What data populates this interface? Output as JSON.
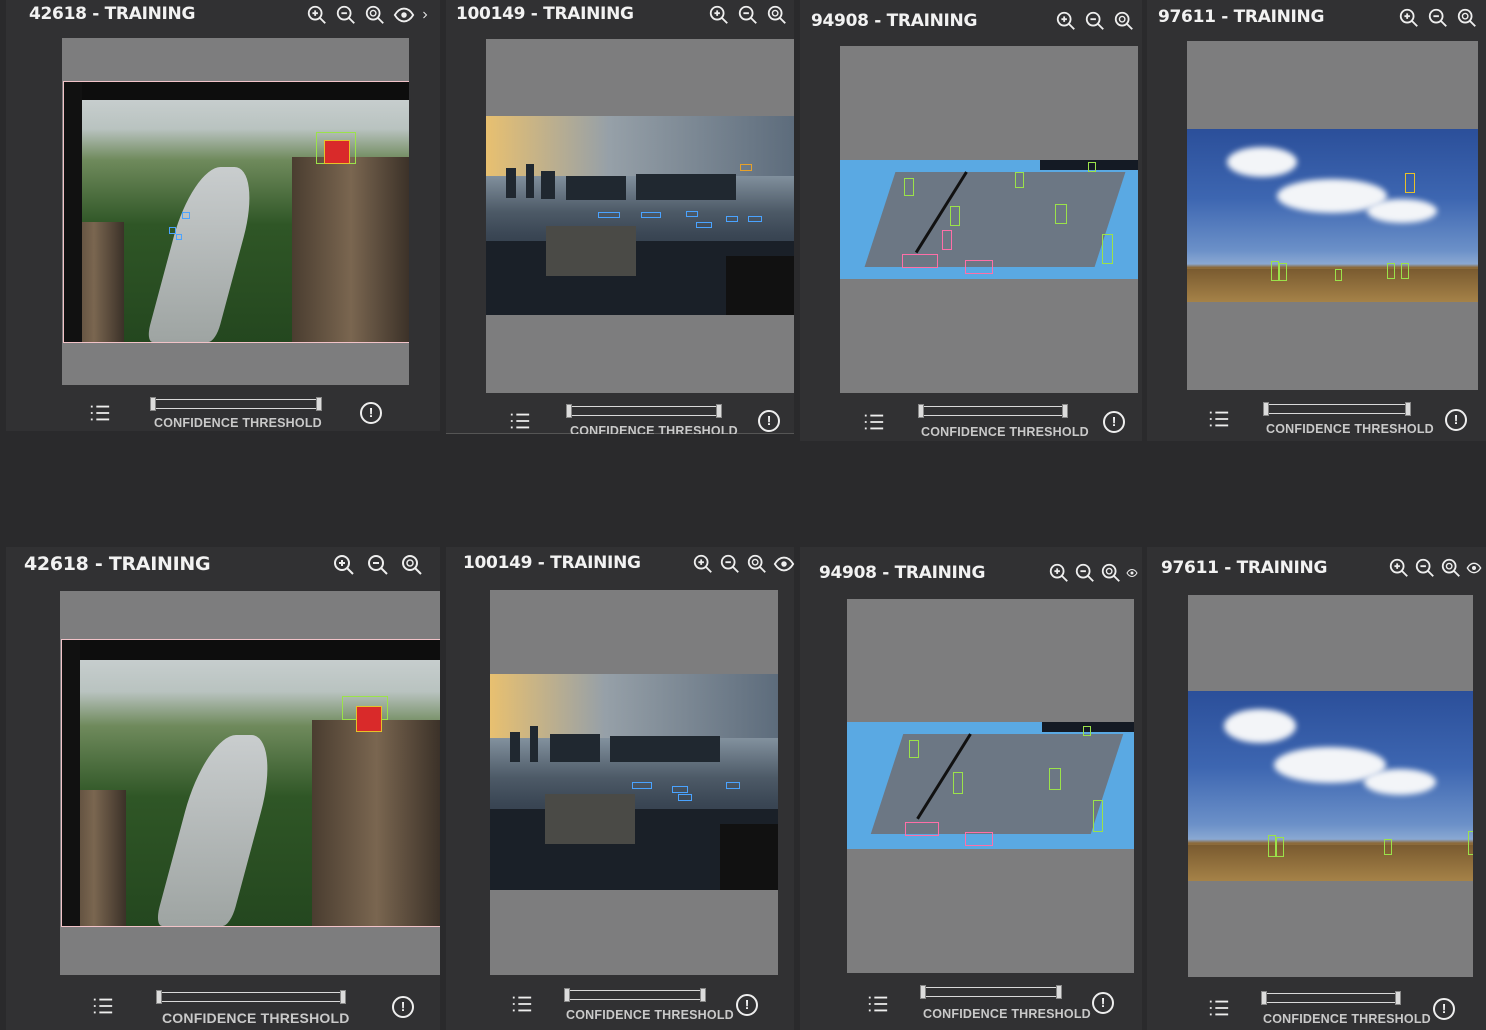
{
  "panels": [
    {
      "title": "42618 - TRAINING",
      "slider_label": "CONFIDENCE THRESHOLD"
    },
    {
      "title": "100149 - TRAINING",
      "slider_label": "CONFIDENCE THRESHOLD"
    },
    {
      "title": "94908 - TRAINING",
      "slider_label": "CONFIDENCE THRESHOLD"
    },
    {
      "title": "97611 - TRAINING",
      "slider_label": "CONFIDENCE THRESHOLD"
    },
    {
      "title": "42618 - TRAINING",
      "slider_label": "CONFIDENCE THRESHOLD"
    },
    {
      "title": "100149 - TRAINING",
      "slider_label": "CONFIDENCE THRESHOLD"
    },
    {
      "title": "94908 - TRAINING",
      "slider_label": "CONFIDENCE THRESHOLD"
    },
    {
      "title": "97611 - TRAINING",
      "slider_label": "CONFIDENCE THRESHOLD"
    }
  ],
  "icons": [
    "zoom-in-icon",
    "zoom-out-icon",
    "zoom-fit-icon",
    "eye-icon",
    "chevron-right-icon",
    "list-icon",
    "info-icon"
  ],
  "colors": {
    "background": "#2a2a2c",
    "panel": "#313133",
    "canvas": "#7d7d7e",
    "box_blue": "#4aa3ff",
    "box_green": "#9be24a",
    "box_yellow": "#e7c12a",
    "box_pink": "#ff6fa8"
  }
}
